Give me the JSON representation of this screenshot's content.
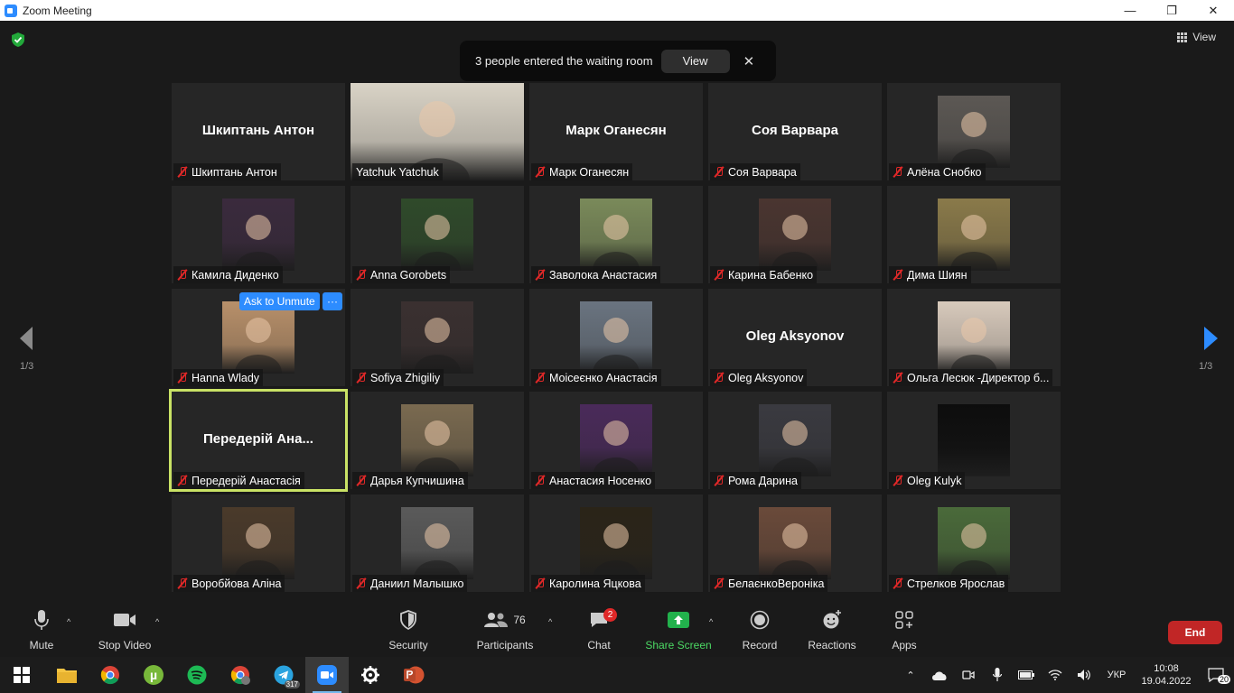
{
  "window": {
    "title": "Zoom Meeting",
    "minimize": "—",
    "restore": "❐",
    "close": "✕"
  },
  "top": {
    "view_label": "View"
  },
  "notification": {
    "text": "3 people entered the waiting room",
    "view_label": "View",
    "close": "✕"
  },
  "tiles": [
    {
      "name": "Шкиптань Антон",
      "big": "Шкиптань Антон",
      "photo": "none"
    },
    {
      "name": "Yatchuk Yatchuk",
      "photo": "full",
      "tone": "#d9d3c6"
    },
    {
      "name": "Марк Оганесян",
      "big": "Марк Оганесян",
      "photo": "none"
    },
    {
      "name": "Соя Варвара",
      "big": "Соя Варвара",
      "photo": "none"
    },
    {
      "name": "Алёна Снобко",
      "photo": "small",
      "tone": "#5c5854"
    },
    {
      "name": "Камила Диденко",
      "photo": "small",
      "tone": "#3a2a3d"
    },
    {
      "name": "Anna Gorobets",
      "photo": "small",
      "tone": "#2f4a2a"
    },
    {
      "name": "Заволока Анастасия",
      "photo": "small",
      "tone": "#7a8a5a"
    },
    {
      "name": "Карина Бабенко",
      "photo": "small",
      "tone": "#4a3530"
    },
    {
      "name": "Дима Шиян",
      "photo": "small",
      "tone": "#8a7a4a"
    },
    {
      "name": "Hanna Wlady",
      "photo": "small",
      "tone": "#b8906a"
    },
    {
      "name": "Sofiya Zhigiliy",
      "photo": "small",
      "tone": "#3a3030"
    },
    {
      "name": "Моісеєнко Анастасія",
      "photo": "small",
      "tone": "#6a7480"
    },
    {
      "name": "Oleg Aksyonov",
      "big": "Oleg Aksyonov",
      "photo": "none"
    },
    {
      "name": "Ольга Лесюк -Директор б...",
      "photo": "small",
      "tone": "#d8cabc"
    },
    {
      "name": "Передерій Анастасія",
      "big": "Передерій Ана...",
      "photo": "none"
    },
    {
      "name": "Дарья Купчишина",
      "photo": "small",
      "tone": "#7a6a50"
    },
    {
      "name": "Анастасия Носенко",
      "photo": "small",
      "tone": "#4a2a5a"
    },
    {
      "name": "Рома Дарина",
      "photo": "small",
      "tone": "#3a3a40"
    },
    {
      "name": "Oleg Kulyk",
      "photo": "small",
      "tone": "#0d0d0d"
    },
    {
      "name": "Воробйова Аліна",
      "photo": "small",
      "tone": "#4a3a2a"
    },
    {
      "name": "Даниил Малышко",
      "photo": "small",
      "tone": "#5a5a5a"
    },
    {
      "name": "Каролина Яцкова",
      "photo": "small",
      "tone": "#2a2418"
    },
    {
      "name": "БелаєнкоВероніка",
      "photo": "small",
      "tone": "#6a4a3a"
    },
    {
      "name": "Стрелков Ярослав",
      "photo": "small",
      "tone": "#4a6a3a"
    }
  ],
  "hover": {
    "ask_unmute": "Ask to Unmute",
    "more": "···"
  },
  "pagination": {
    "left": "1/3",
    "right": "1/3"
  },
  "toolbar": {
    "mute": "Mute",
    "stop_video": "Stop Video",
    "security": "Security",
    "participants": "Participants",
    "participants_count": "76",
    "chat": "Chat",
    "chat_badge": "2",
    "share_screen": "Share Screen",
    "record": "Record",
    "reactions": "Reactions",
    "apps": "Apps",
    "end": "End"
  },
  "taskbar": {
    "telegram_badge": "317",
    "language": "УКР",
    "time": "10:08",
    "date": "19.04.2022",
    "notifications": "20"
  },
  "colors": {
    "accent": "#2d8cff",
    "active_speaker": "#c9e265",
    "end": "#c12626",
    "share_green": "#22b14c",
    "mic_off": "#e02828"
  }
}
